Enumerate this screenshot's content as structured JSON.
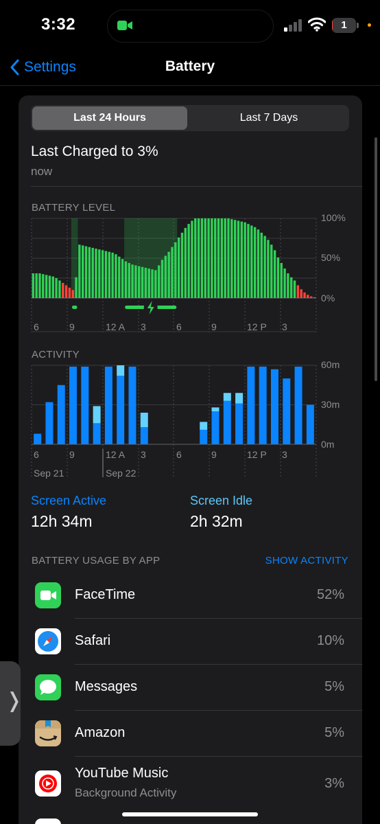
{
  "status": {
    "time": "3:32",
    "battery_text": "1",
    "battery_level": 0.01
  },
  "nav": {
    "back_label": "Settings",
    "title": "Battery"
  },
  "segment": {
    "active": "Last 24 Hours",
    "inactive": "Last 7 Days"
  },
  "charge": {
    "title": "Last Charged to 3%",
    "subtitle": "now"
  },
  "battery_level": {
    "label": "BATTERY LEVEL",
    "y_ticks": [
      "100%",
      "50%",
      "0%"
    ],
    "x_ticks": [
      "6",
      "9",
      "12 A",
      "3",
      "6",
      "9",
      "12 P",
      "3"
    ]
  },
  "activity": {
    "label": "ACTIVITY",
    "y_ticks": [
      "60m",
      "30m",
      "0m"
    ],
    "x_ticks": [
      "6",
      "9",
      "12 A",
      "3",
      "6",
      "9",
      "12 P",
      "3"
    ],
    "dates": [
      "Sep 21",
      "Sep 22"
    ]
  },
  "screen": {
    "active_label": "Screen Active",
    "active_value": "12h 34m",
    "idle_label": "Screen Idle",
    "idle_value": "2h 32m"
  },
  "usage": {
    "header": "BATTERY USAGE BY APP",
    "show_activity": "SHOW ACTIVITY",
    "apps": [
      {
        "name": "FaceTime",
        "sub": "",
        "pct": "52%",
        "icon": "facetime-icon"
      },
      {
        "name": "Safari",
        "sub": "",
        "pct": "10%",
        "icon": "safari-icon"
      },
      {
        "name": "Messages",
        "sub": "",
        "pct": "5%",
        "icon": "messages-icon"
      },
      {
        "name": "Amazon",
        "sub": "",
        "pct": "5%",
        "icon": "amazon-icon"
      },
      {
        "name": "YouTube Music",
        "sub": "Background Activity",
        "pct": "3%",
        "icon": "youtube-music-icon"
      }
    ]
  },
  "colors": {
    "green": "#30d158",
    "red": "#ff453a",
    "blue": "#0a84ff",
    "light_blue": "#64d2ff",
    "teal_label": "#5ac8fa"
  },
  "chart_data": [
    {
      "type": "bar",
      "title": "BATTERY LEVEL",
      "ylim": [
        0,
        100
      ],
      "unit": "%",
      "x_ticks": [
        "6",
        "9",
        "12 A",
        "3",
        "6",
        "9",
        "12 P",
        "3"
      ],
      "values": [
        31,
        31,
        31,
        30,
        29,
        28,
        27,
        25,
        22,
        19,
        16,
        13,
        10,
        26,
        67,
        66,
        65,
        64,
        63,
        62,
        61,
        60,
        59,
        58,
        57,
        55,
        52,
        49,
        46,
        44,
        42,
        41,
        40,
        39,
        38,
        37,
        36,
        35,
        41,
        48,
        53,
        58,
        64,
        70,
        76,
        82,
        88,
        93,
        97,
        100,
        100,
        100,
        100,
        100,
        100,
        100,
        100,
        100,
        100,
        100,
        99,
        98,
        97,
        96,
        95,
        93,
        91,
        89,
        86,
        82,
        78,
        73,
        67,
        60,
        51,
        44,
        37,
        31,
        26,
        22,
        16,
        11,
        7,
        4,
        2,
        1
      ],
      "low_threshold": 20,
      "charging_ranges": [
        [
          12,
          13
        ],
        [
          28,
          43
        ]
      ]
    },
    {
      "type": "bar",
      "title": "ACTIVITY",
      "ylim": [
        0,
        60
      ],
      "unit": "m",
      "x_ticks": [
        "6",
        "9",
        "12 A",
        "3",
        "6",
        "9",
        "12 P",
        "3"
      ],
      "series": [
        {
          "name": "Screen Active",
          "values": [
            8,
            32,
            45,
            59,
            59,
            16,
            59,
            52,
            59,
            13,
            0,
            0,
            0,
            0,
            11,
            25,
            33,
            31,
            59,
            59,
            57,
            50,
            59,
            30
          ]
        },
        {
          "name": "Screen Idle",
          "values": [
            0,
            0,
            0,
            0,
            0,
            13,
            0,
            8,
            0,
            11,
            0,
            0,
            0,
            0,
            6,
            3,
            6,
            8,
            0,
            0,
            0,
            0,
            0,
            0
          ]
        }
      ]
    }
  ]
}
